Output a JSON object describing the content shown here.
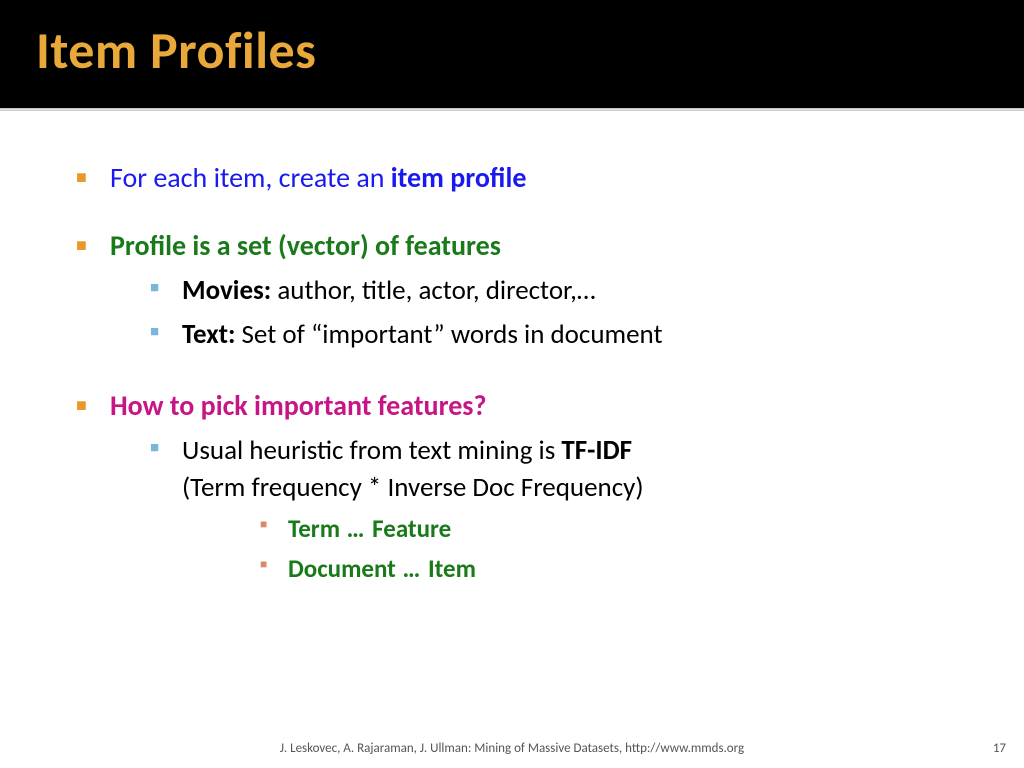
{
  "title": "Item Profiles",
  "bullets": {
    "b1_pre": "For each item, create an ",
    "b1_bold": "item profile",
    "b2": "Profile is a set (vector) of features",
    "b2a_label": "Movies:",
    "b2a_text": " author, title, actor, director,…",
    "b2b_label": "Text:",
    "b2b_text": " Set of “important” words in document",
    "b3": "How to pick important features?",
    "b3a_pre": "Usual heuristic from text mining is ",
    "b3a_bold": "TF-IDF",
    "b3a_line2": "(Term frequency * Inverse Doc Frequency)",
    "b3a1_a": "Term",
    "b3a1_mid": " … ",
    "b3a1_b": "Feature",
    "b3a2_a": "Document",
    "b3a2_mid": " … ",
    "b3a2_b": "Item"
  },
  "footer": "J. Leskovec, A. Rajaraman, J. Ullman: Mining of Massive Datasets, http://www.mmds.org",
  "page": "17"
}
